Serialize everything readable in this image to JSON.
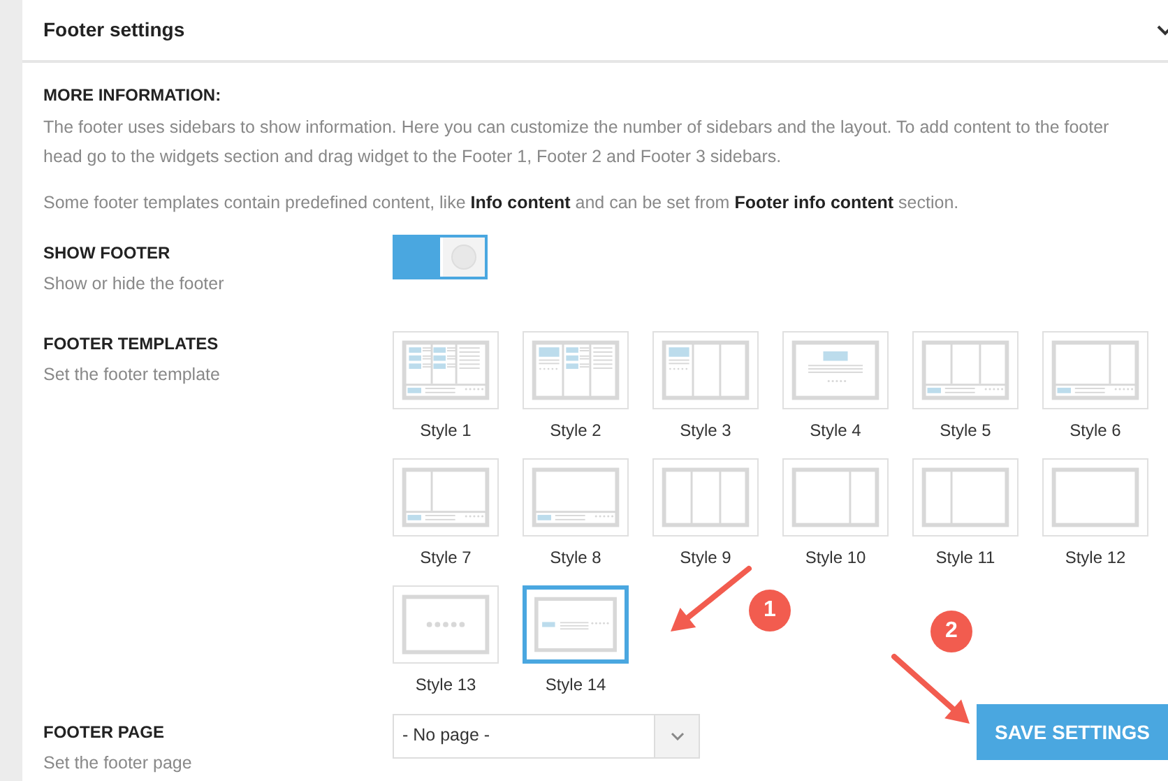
{
  "panel": {
    "title": "Footer settings",
    "expanded": true
  },
  "info": {
    "heading": "MORE INFORMATION:",
    "paragraphs": [
      "The footer uses sidebars to show information. Here you can customize the number of sidebars and the layout. To add content to the footer head go to the widgets section and drag widget to the Footer 1, Footer 2 and Footer 3 sidebars.",
      "Some footer templates contain predefined content, like **Info content** and can be set from **Footer info content** section."
    ]
  },
  "show_footer": {
    "label": "SHOW FOOTER",
    "hint": "Show or hide the footer",
    "on": true
  },
  "templates": {
    "label": "FOOTER TEMPLATES",
    "hint": "Set the footer template",
    "items": [
      {
        "label": "Style 1",
        "kind": "grid",
        "selected": false
      },
      {
        "label": "Style 2",
        "kind": "feature",
        "selected": false
      },
      {
        "label": "Style 3",
        "kind": "featureplain",
        "selected": false
      },
      {
        "label": "Style 4",
        "kind": "centered",
        "selected": false
      },
      {
        "label": "Style 5",
        "kind": "thirdsbar",
        "selected": false
      },
      {
        "label": "Style 6",
        "kind": "widebar",
        "selected": false
      },
      {
        "label": "Style 7",
        "kind": "narrowbar",
        "selected": false
      },
      {
        "label": "Style 8",
        "kind": "bar",
        "selected": false
      },
      {
        "label": "Style 9",
        "kind": "thirds",
        "selected": false
      },
      {
        "label": "Style 10",
        "kind": "wide",
        "selected": false
      },
      {
        "label": "Style 11",
        "kind": "narrow",
        "selected": false
      },
      {
        "label": "Style 12",
        "kind": "single",
        "selected": false
      },
      {
        "label": "Style 13",
        "kind": "dots",
        "selected": false
      },
      {
        "label": "Style 14",
        "kind": "baronly",
        "selected": true
      }
    ]
  },
  "footer_page": {
    "label": "FOOTER PAGE",
    "hint": "Set the footer page",
    "value": "- No page -"
  },
  "save_button": "SAVE SETTINGS",
  "annotations": [
    {
      "label": "1"
    },
    {
      "label": "2"
    }
  ]
}
